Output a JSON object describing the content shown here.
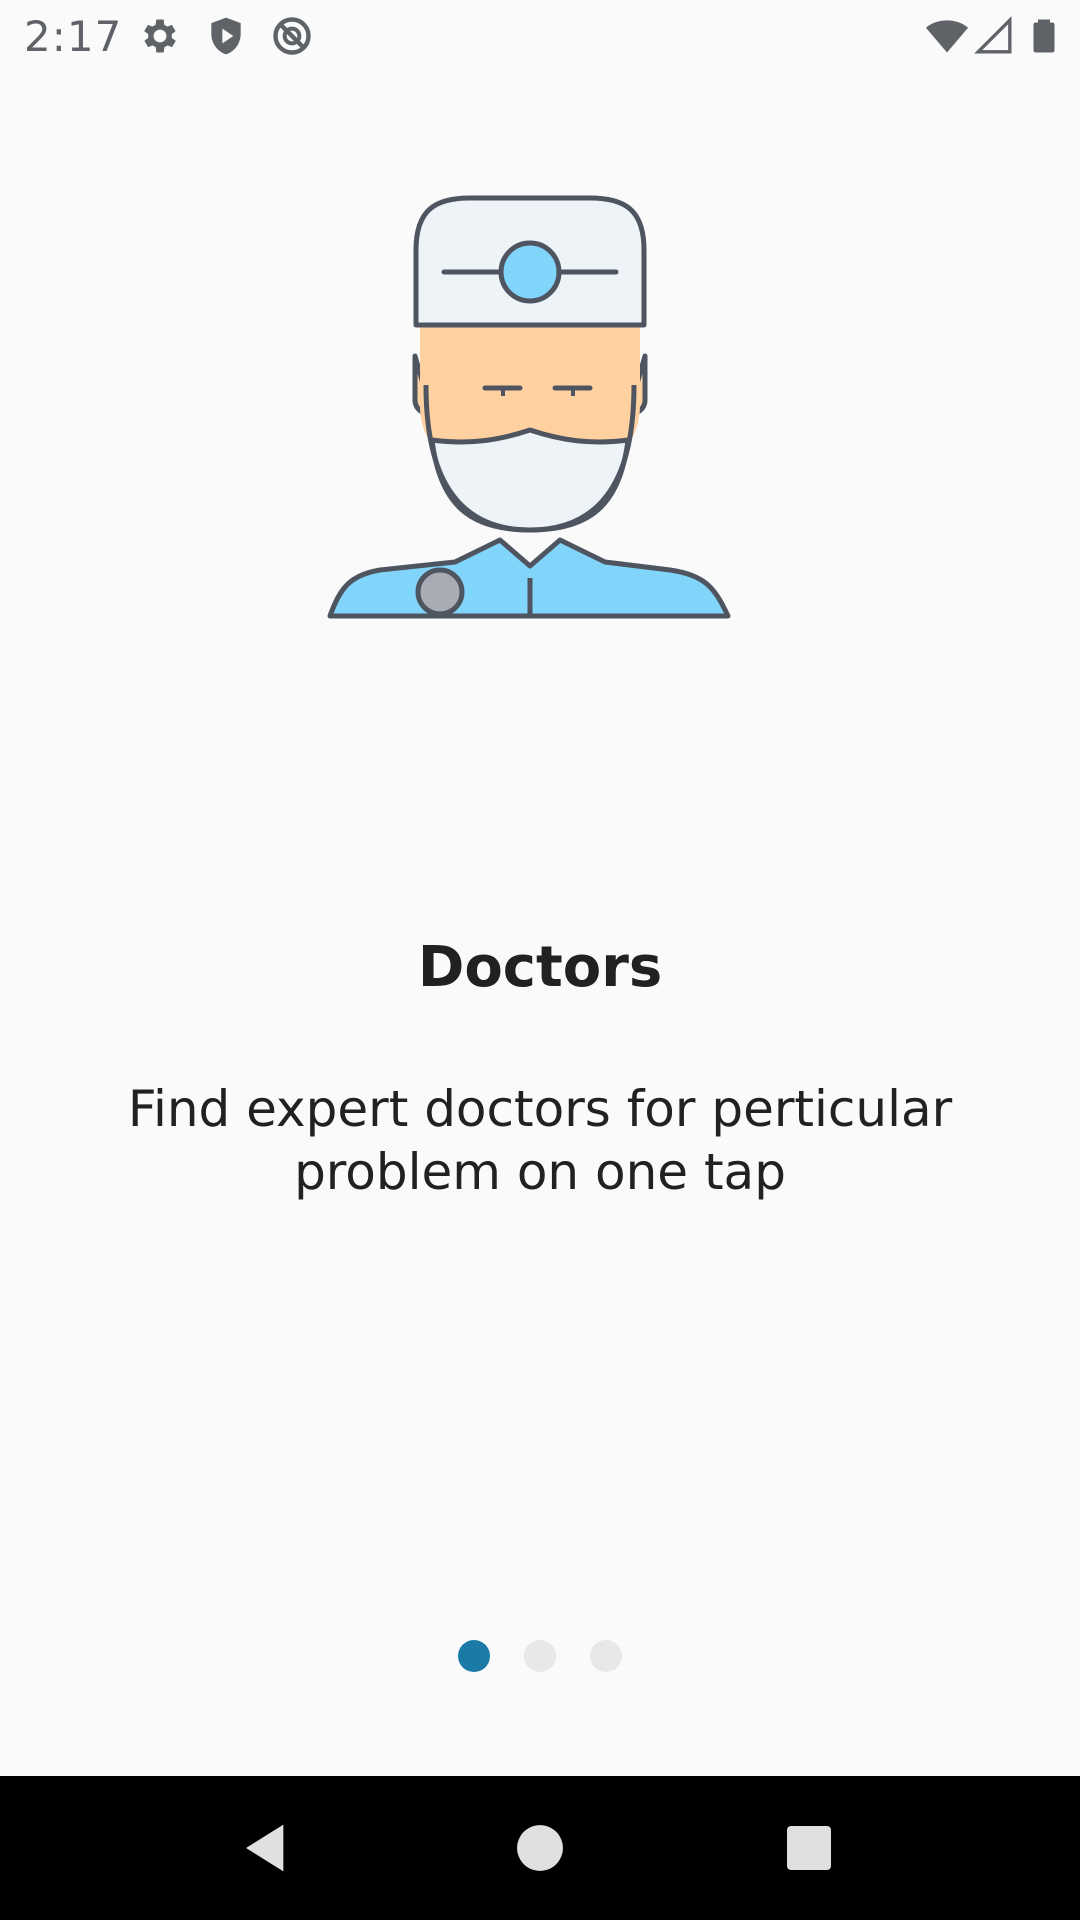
{
  "status_bar": {
    "time": "2:17",
    "left_icons": [
      "settings-icon",
      "play-protect-icon",
      "do-not-disturb-icon"
    ],
    "right_icons": [
      "wifi-icon",
      "signal-icon",
      "battery-icon"
    ]
  },
  "onboarding": {
    "illustration": "doctor-icon",
    "title": "Doctors",
    "description": "Find expert doctors for perticular problem on one tap",
    "page_count": 3,
    "active_page": 1
  },
  "colors": {
    "accent": "#1c7aa6",
    "inactive_dot": "#e8e8e8",
    "background": "#fafafa",
    "text": "#212121"
  },
  "nav_bar": {
    "buttons": [
      "back-icon",
      "home-icon",
      "recents-icon"
    ]
  }
}
